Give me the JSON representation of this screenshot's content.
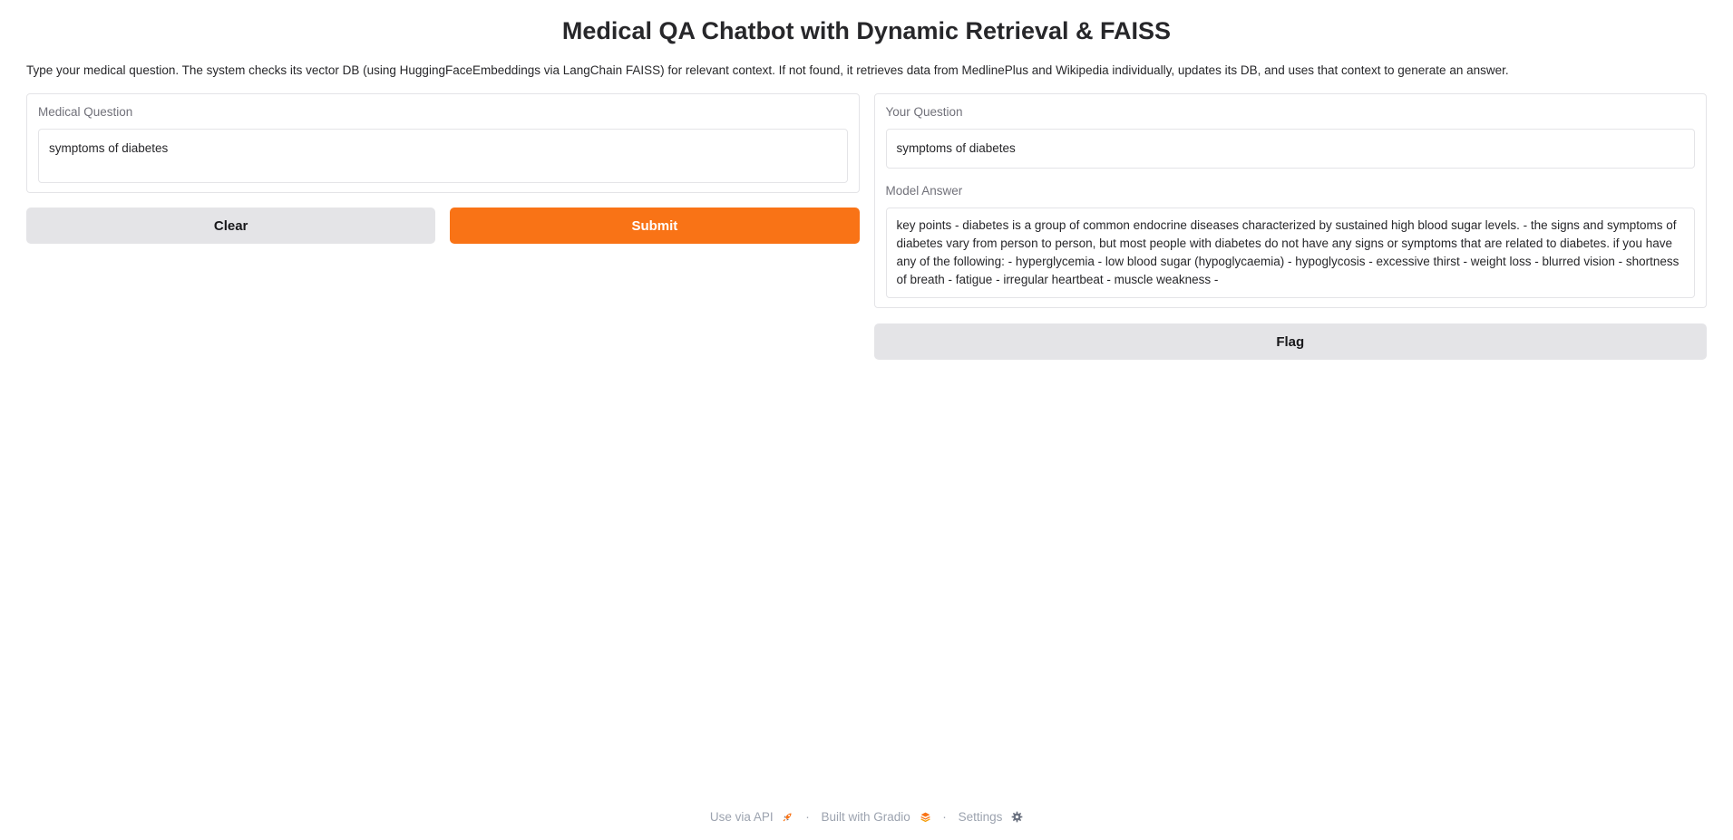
{
  "app": {
    "title": "Medical QA Chatbot with Dynamic Retrieval & FAISS",
    "description": "Type your medical question. The system checks its vector DB (using HuggingFaceEmbeddings via LangChain FAISS) for relevant context. If not found, it retrieves data from MedlinePlus and Wikipedia individually, updates its DB, and uses that context to generate an answer."
  },
  "input_panel": {
    "label": "Medical Question",
    "value": "symptoms of diabetes",
    "clear_label": "Clear",
    "submit_label": "Submit"
  },
  "output_panel": {
    "question_label": "Your Question",
    "question_value": "symptoms of diabetes",
    "answer_label": "Model Answer",
    "answer_value": "key points - diabetes is a group of common endocrine diseases characterized by sustained high blood sugar levels. - the signs and symptoms of diabetes vary from person to person, but most people with diabetes do not have any signs or symptoms that are related to diabetes. if you have any of the following: - hyperglycemia - low blood sugar (hypoglycaemia) - hypoglycosis - excessive thirst - weight loss - blurred vision - shortness of breath - fatigue - irregular heartbeat - muscle weakness -",
    "flag_label": "Flag"
  },
  "footer": {
    "api_label": "Use via API",
    "separator": "·",
    "built_label": "Built with Gradio",
    "settings_label": "Settings",
    "icons": [
      "rocket-icon",
      "gradio-logo-icon",
      "gear-icon"
    ]
  },
  "colors": {
    "primary": "#f97316",
    "secondary": "#e4e4e7",
    "border": "#e4e4e7",
    "label": "#71717a"
  }
}
